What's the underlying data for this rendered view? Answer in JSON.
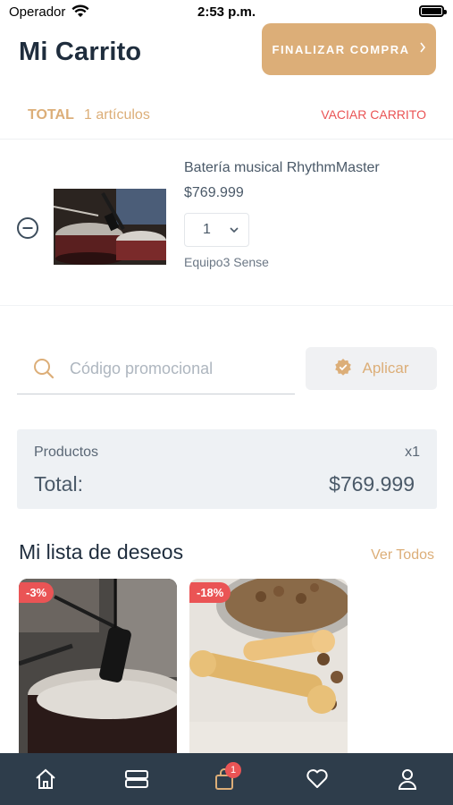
{
  "status_bar": {
    "carrier": "Operador",
    "time": "2:53 p.m."
  },
  "header": {
    "title": "Mi Carrito",
    "checkout_label": "FINALIZAR COMPRA"
  },
  "total_bar": {
    "label": "TOTAL",
    "count": "1 artículos",
    "clear_label": "VACIAR CARRITO"
  },
  "cart_items": [
    {
      "name": "Batería musical RhythmMaster",
      "price": "$769.999",
      "quantity": "1",
      "vendor": "Equipo3 Sense"
    }
  ],
  "promo": {
    "placeholder": "Código promocional",
    "apply_label": "Aplicar"
  },
  "summary": {
    "products_label": "Productos",
    "products_count": "x1",
    "total_label": "Total:",
    "total_value": "$769.999"
  },
  "wishlist": {
    "title": "Mi lista de deseos",
    "view_all": "Ver Todos",
    "items": [
      {
        "discount": "-3%"
      },
      {
        "discount": "-18%"
      }
    ]
  },
  "tab_bar": {
    "cart_badge": "1",
    "tabs": [
      "home-icon",
      "categories-icon",
      "cart-icon",
      "heart-icon",
      "user-icon"
    ]
  },
  "colors": {
    "accent": "#dcae78",
    "danger": "#ea5455",
    "tab_bar": "#2e3d4b"
  }
}
